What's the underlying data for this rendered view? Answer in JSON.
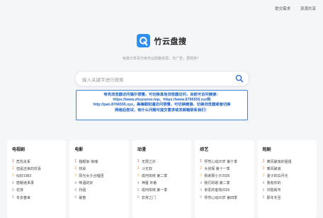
{
  "top_links": [
    "提交需求",
    "资源共享"
  ],
  "brand": {
    "name": "竹云盘搜",
    "tagline": "免费分享百万级专业网盘资源，无广告，更轻快！"
  },
  "search": {
    "placeholder": "输入关键字进行搜索"
  },
  "notice": {
    "lines": [
      "夸克浏览器访问偶尔很慢，可切换其他浏览器访问，目前可访问链接：",
      "https://www.zhuyunso.top、https://www.8766555.xyz和",
      "http://pan.8766555.xyz，高峰期如遇访问很慢，可切换链接、切换浏览器或者切换",
      "网络后尝试，有什么问题可提交需求或发邮箱联系我们！"
    ]
  },
  "categories": [
    {
      "title": "电视剧",
      "items": [
        "危险关系",
        "但是还来的欢喜",
        "似好1983",
        "唐朝诡事录",
        "花芽",
        "冬去春来"
      ]
    },
    {
      "title": "电影",
      "items": [
        "独眼枭·惊魂",
        "拼桌",
        "阳光女子合唱团",
        "啤酒的好",
        "扫函",
        "破茧"
      ]
    },
    {
      "title": "动漫",
      "items": [
        "无限之外",
        "斗无双",
        "成何体统 第二季",
        "神墓 年番",
        "成何体统 第一季",
        "非常之门"
      ]
    },
    {
      "title": "综艺",
      "items": [
        "怦然心动20岁 第十季",
        "大侦探 第十一季",
        "我家那小子2026",
        "我们的歌 第二季",
        "亲爱的客栈2026",
        "怦然心动20岁 第四季"
      ]
    },
    {
      "title": "短剧",
      "items": [
        "乘风破浪的姐姐",
        "乘风破浪",
        "妻子的白月光",
        "我有你的",
        "归隐街市",
        "那年冬至"
      ]
    }
  ],
  "colors": {
    "accent": "#2f8ff0",
    "notice": "#1a5fc4",
    "rank1": "#e5483b",
    "rank2": "#f0883a",
    "rank3": "#f3b23c"
  },
  "icons": {
    "logo": "q-logo-icon",
    "search": "search-icon"
  }
}
